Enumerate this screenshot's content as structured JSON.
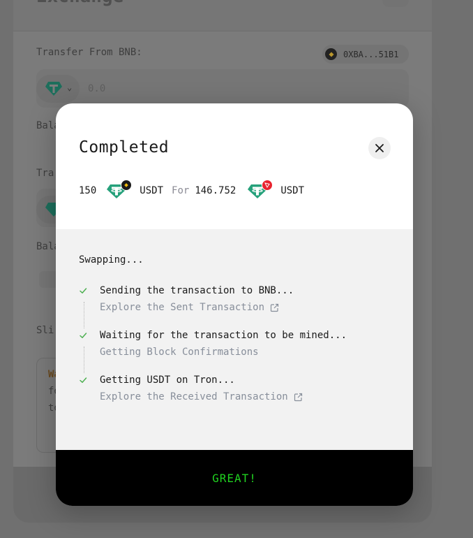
{
  "background": {
    "title": "Exchange",
    "transfer_from_label": "Transfer From BNB:",
    "wallet_address": "0XBA...51B1",
    "amount_placeholder": "0.0",
    "balance_label_1": "Bala",
    "transfer_to_label": "Tra",
    "balance_label_2": "Bala",
    "slippage_label": "Sli",
    "warning_prefix": "Wa",
    "warning_line_1": "fo",
    "warning_line_2": "to"
  },
  "modal": {
    "title": "Completed",
    "summary": {
      "from_amount": "150",
      "from_token": "USDT",
      "for_word": "For",
      "to_amount": "146.752",
      "to_token": "USDT"
    },
    "progress_title": "Swapping...",
    "steps": [
      {
        "title": "Sending the transaction to BNB...",
        "subtitle": "Explore the Sent Transaction",
        "status": "done",
        "link": true
      },
      {
        "title": "Waiting for the transaction to be mined...",
        "subtitle": "Getting Block Confirmations",
        "status": "done",
        "link": false
      },
      {
        "title": "Getting USDT on Tron...",
        "subtitle": "Explore the Received Transaction",
        "status": "done",
        "link": true
      }
    ],
    "confirm_button": "GREAT!"
  },
  "colors": {
    "tether": "#26a17b",
    "check": "#4caf50",
    "button_text": "#20d020",
    "muted_link": "#878e9a",
    "tron_badge": "#e8232f"
  },
  "icons": [
    "close-icon",
    "check-icon",
    "external-link-icon",
    "tether-icon",
    "bnb-badge-icon",
    "tron-badge-icon"
  ]
}
